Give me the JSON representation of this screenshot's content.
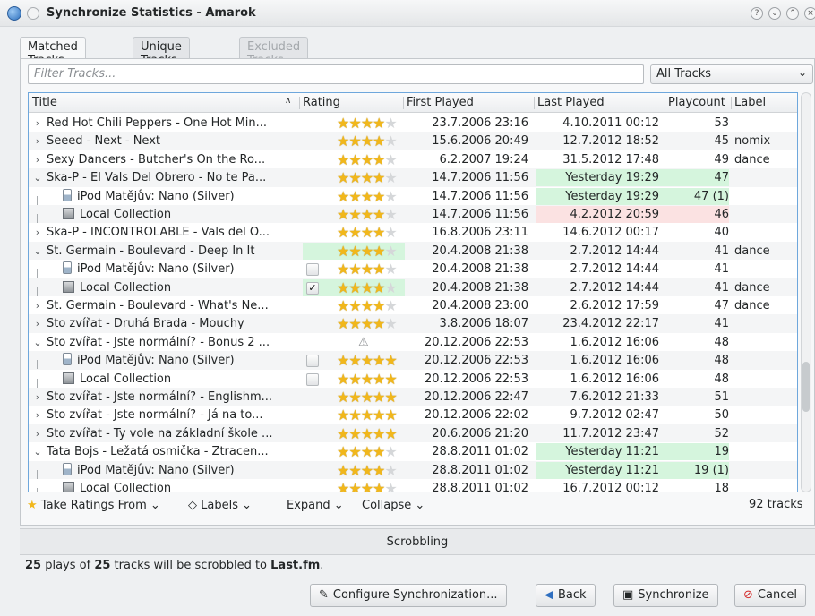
{
  "window": {
    "title": "Synchronize Statistics - Amarok"
  },
  "tabs": [
    {
      "label": "Matched Tracks",
      "state": "active"
    },
    {
      "label": "Unique Tracks",
      "state": "normal"
    },
    {
      "label": "Excluded Tracks",
      "state": "disabled"
    }
  ],
  "filter": {
    "placeholder": "Filter Tracks..."
  },
  "scope_combo": {
    "value": "All Tracks"
  },
  "columns": {
    "title": "Title",
    "rating": "Rating",
    "first_played": "First Played",
    "last_played": "Last Played",
    "playcount": "Playcount",
    "label": "Label"
  },
  "rows": [
    {
      "type": "parent",
      "expander": "collapsed",
      "title": "Red Hot Chili Peppers - One Hot Min...",
      "rating": 4,
      "first": "23.7.2006 23:16",
      "last": "4.10.2011 00:12",
      "play": "53",
      "label": ""
    },
    {
      "type": "parent",
      "expander": "collapsed",
      "title": "Seeed - Next - Next",
      "rating": 4,
      "first": "15.6.2006 20:49",
      "last": "12.7.2012 18:52",
      "play": "45",
      "label": "nomix"
    },
    {
      "type": "parent",
      "expander": "collapsed",
      "title": "Sexy Dancers - Butcher's On the Ro...",
      "rating": 4,
      "first": "6.2.2007 19:24",
      "last": "31.5.2012 17:48",
      "play": "49",
      "label": "dance"
    },
    {
      "type": "parent",
      "expander": "expanded",
      "title": "Ska-P - El Vals Del Obrero - No te Pa...",
      "rating": 4,
      "first": "14.7.2006 11:56",
      "last": "Yesterday 19:29",
      "play": "47",
      "label": "",
      "last_hl": "green",
      "play_hl": "green"
    },
    {
      "type": "child",
      "source": "ipod",
      "title": "iPod Matějův: Nano (Silver)",
      "rating": 4,
      "first": "14.7.2006 11:56",
      "last": "Yesterday 19:29",
      "play": "47 (1)",
      "label": "",
      "last_hl": "green",
      "play_hl": "green"
    },
    {
      "type": "child",
      "source": "collection",
      "title": "Local Collection",
      "rating": 4,
      "first": "14.7.2006 11:56",
      "last": "4.2.2012 20:59",
      "play": "46",
      "label": "",
      "last_hl": "red",
      "play_hl": "red"
    },
    {
      "type": "parent",
      "expander": "collapsed",
      "title": "Ska-P - INCONTROLABLE - Vals del O...",
      "rating": 4,
      "first": "16.8.2006 23:11",
      "last": "14.6.2012 00:17",
      "play": "40",
      "label": ""
    },
    {
      "type": "parent",
      "expander": "expanded",
      "title": "St. Germain - Boulevard - Deep In It",
      "rating": 3.5,
      "first": "20.4.2008 21:38",
      "last": "2.7.2012 14:44",
      "play": "41",
      "label": "dance",
      "rating_hl": "green"
    },
    {
      "type": "child",
      "source": "ipod",
      "title": "iPod Matějův: Nano (Silver)",
      "rating": 4,
      "checkbox": "unchecked",
      "first": "20.4.2008 21:38",
      "last": "2.7.2012 14:44",
      "play": "41",
      "label": ""
    },
    {
      "type": "child",
      "source": "collection",
      "title": "Local Collection",
      "rating": 3.5,
      "checkbox": "checked",
      "first": "20.4.2008 21:38",
      "last": "2.7.2012 14:44",
      "play": "41",
      "label": "dance",
      "rating_hl": "green"
    },
    {
      "type": "parent",
      "expander": "collapsed",
      "title": "St. Germain - Boulevard - What's Ne...",
      "rating": 4,
      "first": "20.4.2008 23:00",
      "last": "2.6.2012 17:59",
      "play": "47",
      "label": "dance"
    },
    {
      "type": "parent",
      "expander": "collapsed",
      "title": "Sto zvířat - Druhá Brada - Mouchy",
      "rating": 4,
      "first": "3.8.2006 18:07",
      "last": "23.4.2012 22:17",
      "play": "41",
      "label": ""
    },
    {
      "type": "parent",
      "expander": "expanded",
      "title": "Sto zvířat - Jste normální? - Bonus 2 ...",
      "rating": null,
      "warning": true,
      "first": "20.12.2006 22:53",
      "last": "1.6.2012 16:06",
      "play": "48",
      "label": ""
    },
    {
      "type": "child",
      "source": "ipod",
      "title": "iPod Matějův: Nano (Silver)",
      "rating": 5,
      "checkbox": "unchecked",
      "first": "20.12.2006 22:53",
      "last": "1.6.2012 16:06",
      "play": "48",
      "label": ""
    },
    {
      "type": "child",
      "source": "collection",
      "title": "Local Collection",
      "rating": 4.5,
      "checkbox": "unchecked",
      "first": "20.12.2006 22:53",
      "last": "1.6.2012 16:06",
      "play": "48",
      "label": ""
    },
    {
      "type": "parent",
      "expander": "collapsed",
      "title": "Sto zvířat - Jste normální? - Englishm...",
      "rating": 5,
      "first": "20.12.2006 22:47",
      "last": "7.6.2012 21:33",
      "play": "51",
      "label": ""
    },
    {
      "type": "parent",
      "expander": "collapsed",
      "title": "Sto zvířat - Jste normální? - Já na to...",
      "rating": 5,
      "first": "20.12.2006 22:02",
      "last": "9.7.2012 02:47",
      "play": "50",
      "label": ""
    },
    {
      "type": "parent",
      "expander": "collapsed",
      "title": "Sto zvířat - Ty vole na základní škole ...",
      "rating": 5,
      "first": "20.6.2006 21:20",
      "last": "11.7.2012 23:47",
      "play": "52",
      "label": ""
    },
    {
      "type": "parent",
      "expander": "expanded",
      "title": "Tata Bojs - Ležatá osmička - Ztracen...",
      "rating": 4,
      "first": "28.8.2011 01:02",
      "last": "Yesterday 11:21",
      "play": "19",
      "label": "",
      "last_hl": "green",
      "play_hl": "green"
    },
    {
      "type": "child",
      "source": "ipod",
      "title": "iPod Matějův: Nano (Silver)",
      "rating": 4,
      "first": "28.8.2011 01:02",
      "last": "Yesterday 11:21",
      "play": "19 (1)",
      "label": "",
      "last_hl": "green",
      "play_hl": "green"
    },
    {
      "type": "child",
      "source": "collection",
      "title": "Local Collection",
      "rating": 4,
      "first": "28.8.2011 01:02",
      "last": "16.7.2012 00:12",
      "play": "18",
      "label": ""
    }
  ],
  "toolbar": {
    "take_ratings": "Take Ratings From",
    "labels": "Labels",
    "expand": "Expand",
    "collapse": "Collapse",
    "track_count": "92 tracks"
  },
  "scrobbling": {
    "header": "Scrobbling",
    "plays": "25",
    "tracks": "25",
    "service": "Last.fm",
    "text_1": " plays of ",
    "text_2": " tracks will be scrobbled to ",
    "text_3": "."
  },
  "buttons": {
    "configure": "Configure Synchronization...",
    "back": "Back",
    "synchronize": "Synchronize",
    "cancel": "Cancel"
  }
}
